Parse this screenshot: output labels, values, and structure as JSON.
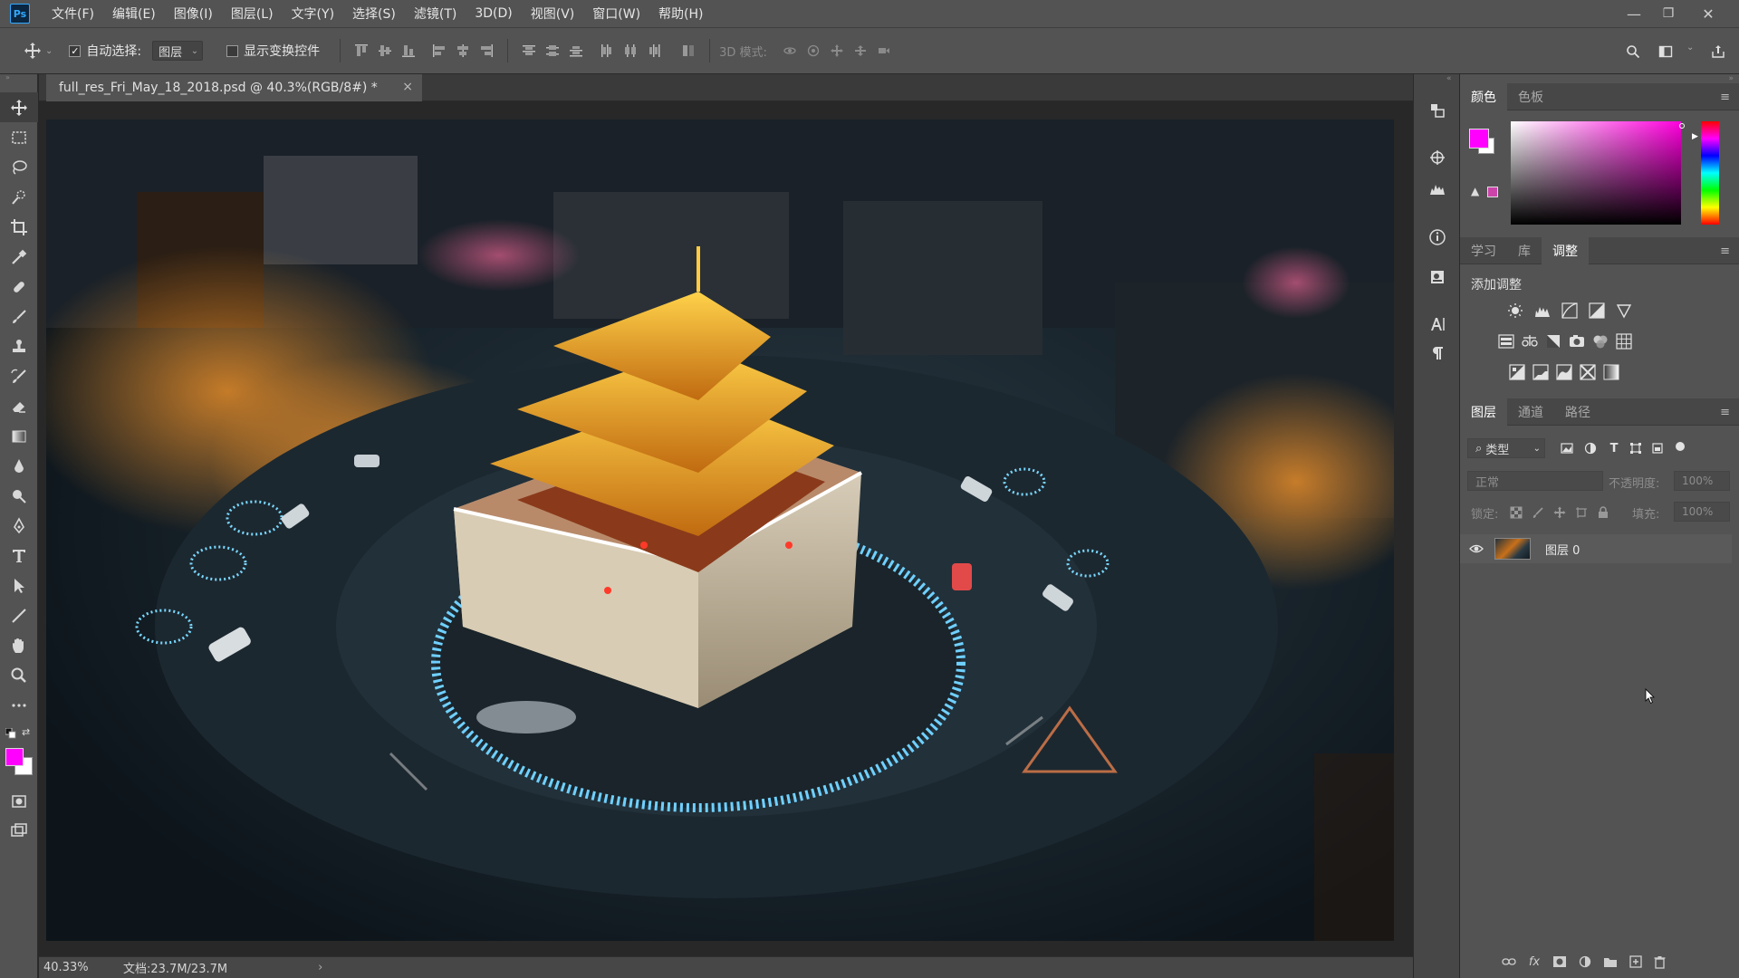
{
  "app": {
    "logo_text": "Ps"
  },
  "menu": {
    "items": [
      "文件(F)",
      "编辑(E)",
      "图像(I)",
      "图层(L)",
      "文字(Y)",
      "选择(S)",
      "滤镜(T)",
      "3D(D)",
      "视图(V)",
      "窗口(W)",
      "帮助(H)"
    ]
  },
  "window_controls": {
    "minimize": "—",
    "restore": "❐",
    "close": "✕"
  },
  "options_bar": {
    "auto_select_label": "自动选择:",
    "auto_select_checked": "✓",
    "auto_select_target": "图层",
    "show_transform_label": "显示变换控件",
    "mode_3d_label": "3D 模式:"
  },
  "document": {
    "tab_title": "full_res_Fri_May_18_2018.psd @ 40.3%(RGB/8#) *",
    "close_symbol": "×"
  },
  "status": {
    "zoom": "40.33%",
    "doc_info": "文档:23.7M/23.7M",
    "arrow": "›"
  },
  "colors": {
    "foreground": "#ff00ff",
    "background": "#ffffff",
    "accent": "#31a8ff"
  },
  "color_panel": {
    "tabs": [
      "颜色",
      "色板"
    ],
    "active_tab": "颜色"
  },
  "adjust_panel": {
    "tabs": [
      "学习",
      "库",
      "调整"
    ],
    "active_tab": "调整",
    "heading": "添加调整"
  },
  "layers_panel": {
    "tabs": [
      "图层",
      "通道",
      "路径"
    ],
    "active_tab": "图层",
    "filter_label": "类型",
    "blend_mode": "正常",
    "opacity_label": "不透明度:",
    "opacity_value": "100%",
    "lock_label": "锁定:",
    "fill_label": "填充:",
    "fill_value": "100%",
    "layers": [
      {
        "name": "图层 0",
        "visible": true
      }
    ]
  }
}
